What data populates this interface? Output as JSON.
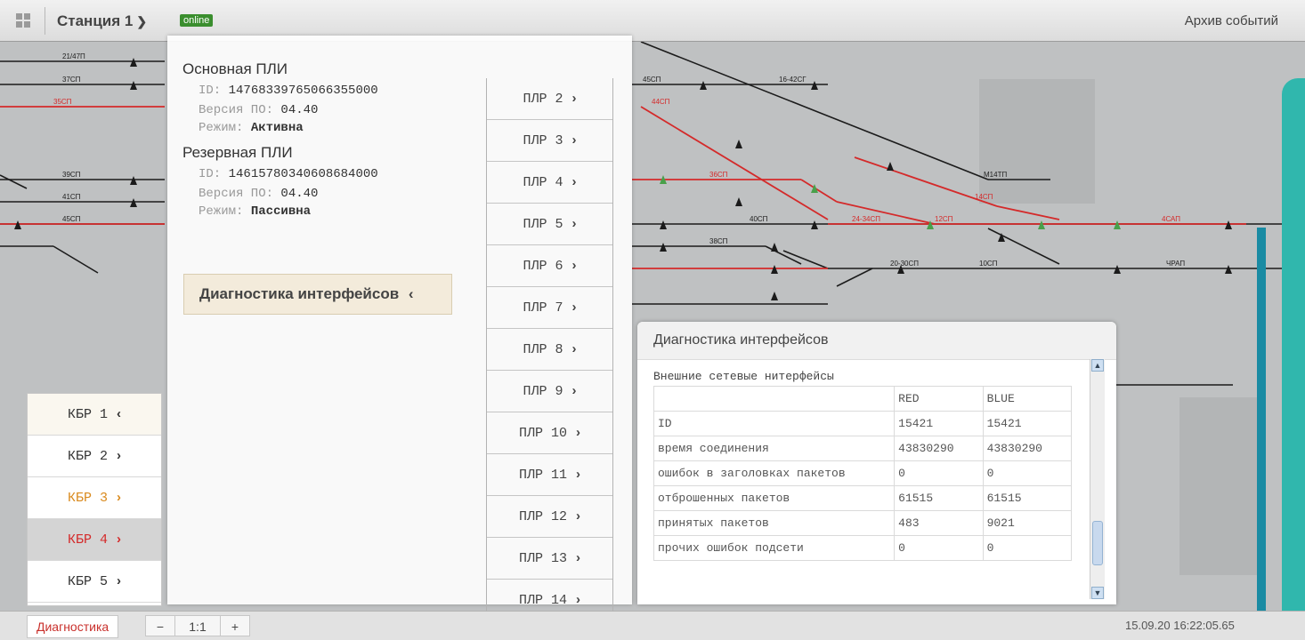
{
  "topbar": {
    "station_label": "Станция 1",
    "status_badge": "online",
    "archive_label": "Архив событий"
  },
  "pli": {
    "main_title": "Основная ПЛИ",
    "main_id_label": "ID:",
    "main_id": "14768339765066355000",
    "main_version_label": "Версия ПО:",
    "main_version": "04.40",
    "main_mode_label": "Режим:",
    "main_mode": "Активна",
    "reserve_title": "Резервная ПЛИ",
    "reserve_id_label": "ID:",
    "reserve_id": "14615780340608684000",
    "reserve_version_label": "Версия ПО:",
    "reserve_version": "04.40",
    "reserve_mode_label": "Режим:",
    "reserve_mode": "Пассивна",
    "diag_button": "Диагностика интерфейсов"
  },
  "plr_items": [
    "ПЛР 2",
    "ПЛР 3",
    "ПЛР 4",
    "ПЛР 5",
    "ПЛР 6",
    "ПЛР 7",
    "ПЛР 8",
    "ПЛР 9",
    "ПЛР 10",
    "ПЛР 11",
    "ПЛР 12",
    "ПЛР 13",
    "ПЛР 14"
  ],
  "kbr_items": [
    {
      "label": "КБР 1",
      "arrow": "‹",
      "color": "#333333",
      "bg": "#faf7ef"
    },
    {
      "label": "КБР 2",
      "arrow": "›",
      "color": "#333333",
      "bg": "#ffffff"
    },
    {
      "label": "КБР 3",
      "arrow": "›",
      "color": "#d98a1e",
      "bg": "#ffffff"
    },
    {
      "label": "КБР 4",
      "arrow": "›",
      "color": "#d42a2a",
      "bg": "#d4d4d4"
    },
    {
      "label": "КБР 5",
      "arrow": "›",
      "color": "#333333",
      "bg": "#ffffff"
    }
  ],
  "diagnostics": {
    "panel_title": "Диагностика интерфейсов",
    "section_title": "Внешние сетевые нитерфейсы",
    "columns": [
      "",
      "RED",
      "BLUE"
    ],
    "rows": [
      [
        "ID",
        "15421",
        "15421"
      ],
      [
        "время соединения",
        "43830290",
        "43830290"
      ],
      [
        "ошибок в заголовках пакетов",
        "0",
        "0"
      ],
      [
        "отброшенных пакетов",
        "61515",
        "61515"
      ],
      [
        "принятых пакетов",
        "483",
        "9021"
      ],
      [
        "прочих ошибок подсети",
        "0",
        "0"
      ]
    ]
  },
  "bottombar": {
    "diag_label": "Диагностика",
    "zoom_out": "−",
    "zoom_level": "1:1",
    "zoom_in": "+",
    "timestamp": "15.09.20 16:22:05.65"
  },
  "track_labels": {
    "left": [
      "21/47П",
      "37СП",
      "35СП",
      "39СП",
      "41СП",
      "45СП"
    ],
    "right": [
      "45СП",
      "16-42СГ",
      "44СП",
      "36СП",
      "М14ТП",
      "14СП",
      "40СП",
      "24-34СП",
      "12СП",
      "38СП",
      "4САП",
      "20-30СП",
      "10СП",
      "ЧРАП"
    ]
  },
  "colors": {
    "accent_red": "#d42a2a",
    "online_green": "#3a8e2e",
    "teal": "#30b7ad"
  }
}
